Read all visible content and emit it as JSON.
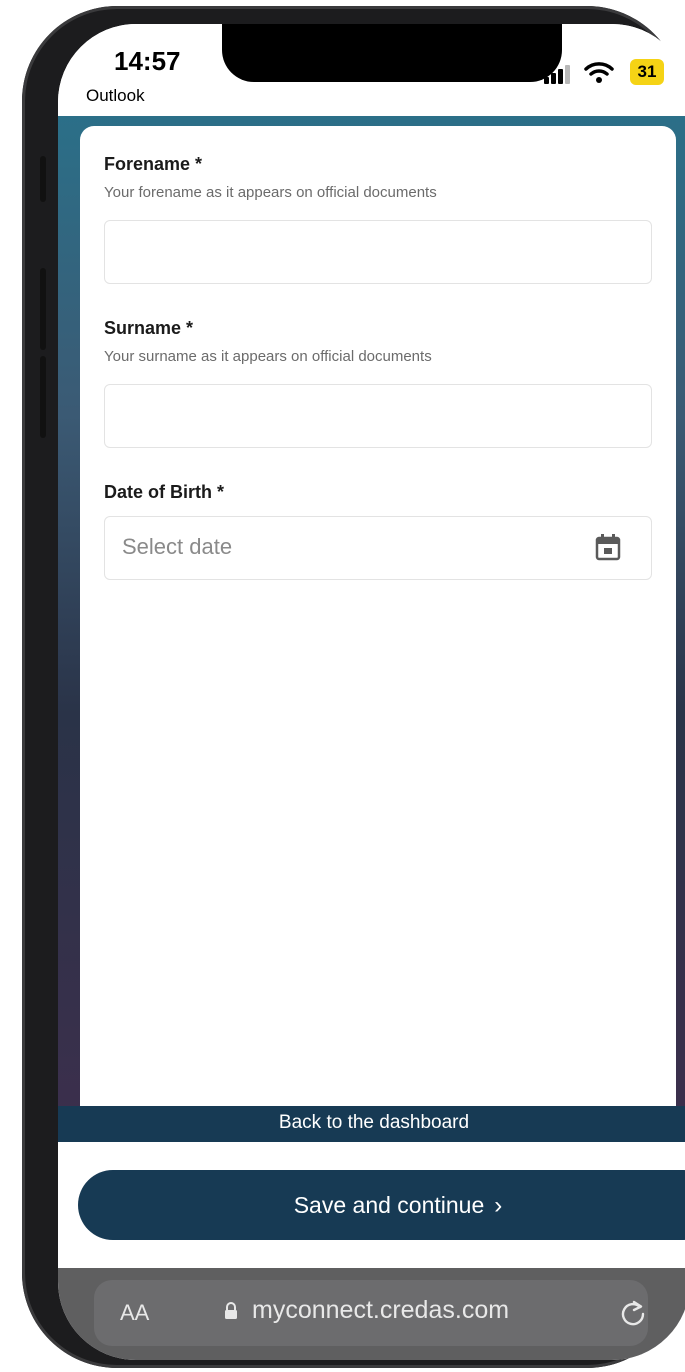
{
  "status_bar": {
    "time": "14:57",
    "back_app": "Outlook",
    "battery": "31",
    "battery_color": "#f5d315"
  },
  "form": {
    "forename": {
      "label": "Forename *",
      "hint": "Your forename as it appears on official documents",
      "value": ""
    },
    "surname": {
      "label": "Surname *",
      "hint": "Your surname as it appears on official documents",
      "value": ""
    },
    "dob": {
      "label": "Date of Birth *",
      "placeholder": "Select date",
      "icon": "calendar-icon"
    }
  },
  "actions": {
    "back_to_dashboard": "Back to the dashboard",
    "save_continue": "Save and continue",
    "save_icon": "chevron-right-icon"
  },
  "browser": {
    "text_size": "AA",
    "url": "myconnect.credas.com",
    "lock_icon": "lock-icon",
    "reload_icon": "reload-icon"
  },
  "colors": {
    "primary": "#173a54",
    "field_border": "#e3e3e3",
    "hint_text": "#6b6b6b"
  }
}
